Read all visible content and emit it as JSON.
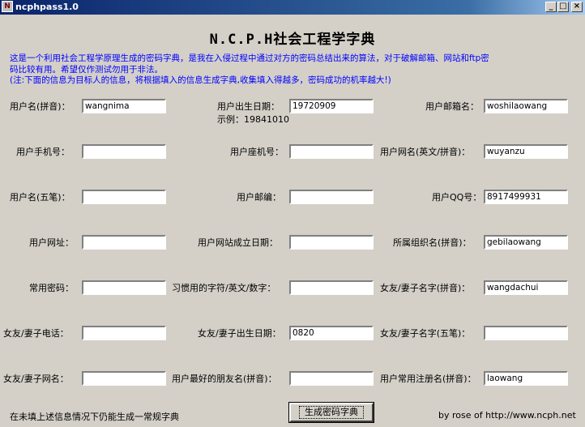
{
  "window": {
    "title": "ncphpass1.0",
    "app_icon": "N",
    "minimize": "_",
    "maximize": "□",
    "close": "×"
  },
  "heading": "N.C.P.H社会工程学字典",
  "description": [
    "这是一个利用社会工程学原理生成的密码字典，是我在入侵过程中通过对方的密码总结出来的算法，对于破解邮箱、网站和ftp密",
    "码比较有用。希望仅作测试勿用于非法。",
    "(注:下面的信息为目标人的信息，将根据填入的信息生成字典,收集填入得越多，密码成功的机率越大!)"
  ],
  "example": "示例：19841010",
  "fields": {
    "username_pinyin": {
      "label": "用户名(拼音)：",
      "value": "wangnima"
    },
    "birthday": {
      "label": "用户出生日期：",
      "value": "19720909"
    },
    "email_name": {
      "label": "用户邮箱名：",
      "value": "woshilaowang"
    },
    "mobile": {
      "label": "用户手机号：",
      "value": ""
    },
    "landline": {
      "label": "用户座机号：",
      "value": ""
    },
    "nickname": {
      "label": "用户网名(英文/拼音)：",
      "value": "wuyanzu"
    },
    "username_wubi": {
      "label": "用户名(五笔)：",
      "value": ""
    },
    "zipcode": {
      "label": "用户邮编：",
      "value": ""
    },
    "qq": {
      "label": "用户QQ号：",
      "value": "8917499931"
    },
    "website": {
      "label": "用户网址：",
      "value": ""
    },
    "site_date": {
      "label": "用户网站成立日期：",
      "value": ""
    },
    "org_name": {
      "label": "所属组织名(拼音)：",
      "value": "gebilaowang"
    },
    "common_pw": {
      "label": "常用密码：",
      "value": ""
    },
    "habit_chars": {
      "label": "习惯用的字符/英文/数字：",
      "value": ""
    },
    "gf_name_pinyin": {
      "label": "女友/妻子名字(拼音)：",
      "value": "wangdachui"
    },
    "gf_phone": {
      "label": "女友/妻子电话：",
      "value": ""
    },
    "gf_birthday": {
      "label": "女友/妻子出生日期：",
      "value": "0820"
    },
    "gf_name_wubi": {
      "label": "女友/妻子名字(五笔)：",
      "value": ""
    },
    "gf_nickname": {
      "label": "女友/妻子网名：",
      "value": ""
    },
    "best_friend": {
      "label": "用户最好的朋友名(拼音)：",
      "value": ""
    },
    "reg_name": {
      "label": "用户常用注册名(拼音)：",
      "value": "laowang"
    }
  },
  "footer": {
    "note": "在未填上述信息情况下仍能生成一常规字典",
    "button": "生成密码字典",
    "credit": "by rose of http://www.ncph.net"
  }
}
